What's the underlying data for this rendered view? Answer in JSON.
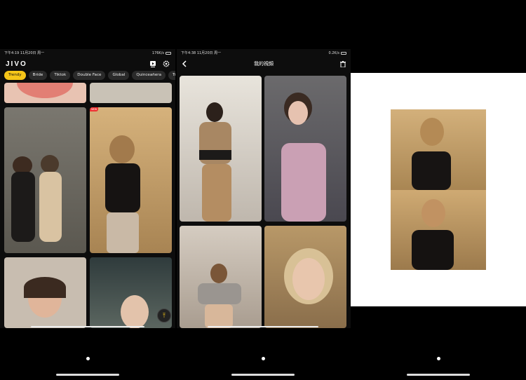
{
  "screen1": {
    "status_time": "下午4:19 11月20日 周一",
    "status_speed": "176K/s",
    "app_name": "JIVO",
    "icons": {
      "video_icon": "video-icon",
      "settings_icon": "gear-icon"
    },
    "chips": [
      "Trendy",
      "Bride",
      "Tiktok",
      "Double Face",
      "Global",
      "Quinceañera",
      "Tra"
    ],
    "active_chip": 0,
    "new_badge": "NEW",
    "fab_icon": "arrow-up-to-top-icon"
  },
  "screen2": {
    "status_time": "下午4:38 11月20日 周一",
    "status_speed": "0.2K/s",
    "title": "我的視頻",
    "icons": {
      "back_icon": "chevron-left-icon",
      "delete_icon": "trash-icon"
    }
  },
  "colors": {
    "accent": "#f5c518",
    "background": "#0d0d0d",
    "chip_bg": "#2a2a2a"
  }
}
